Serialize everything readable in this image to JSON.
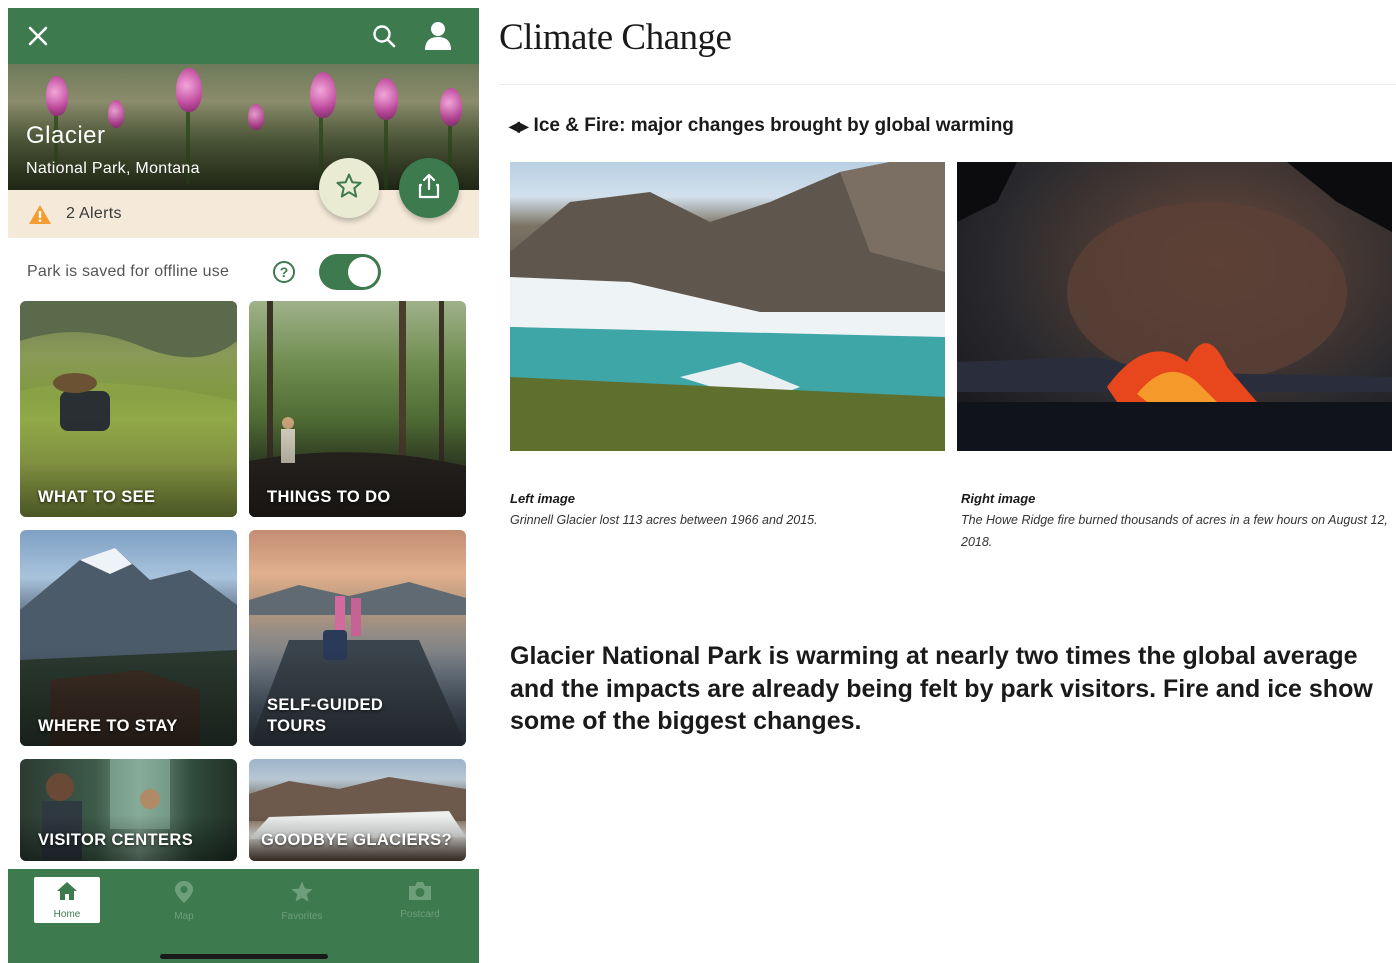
{
  "app": {
    "header": {
      "close_icon": "close-icon",
      "search_icon": "search-icon",
      "profile_icon": "user-icon"
    },
    "park": {
      "name": "Glacier",
      "subtitle": "National Park, Montana"
    },
    "alerts": {
      "label": "2 Alerts",
      "icon": "warning-icon",
      "color": "#f39c32"
    },
    "offline": {
      "label": "Park is saved for offline use",
      "enabled": true
    },
    "tiles": [
      {
        "label": "WHAT TO SEE"
      },
      {
        "label": "THINGS TO DO"
      },
      {
        "label": "WHERE TO STAY"
      },
      {
        "label": "SELF-GUIDED\nTOURS"
      },
      {
        "label": "VISITOR CENTERS"
      },
      {
        "label": "GOODBYE GLACIERS?"
      }
    ],
    "tabs": [
      {
        "label": "Home",
        "icon": "home-icon",
        "active": true
      },
      {
        "label": "Map",
        "icon": "map-pin-icon",
        "active": false
      },
      {
        "label": "Favorites",
        "icon": "star-icon",
        "active": false
      },
      {
        "label": "Postcard",
        "icon": "camera-icon",
        "active": false
      }
    ],
    "colors": {
      "brand_green": "#3d7a4e",
      "alert_bg": "#f5ead9"
    }
  },
  "article": {
    "title": "Climate Change",
    "section_heading": "Ice & Fire: major changes brought by global warming",
    "left_caption": {
      "title": "Left image",
      "text": "Grinnell Glacier lost 113 acres between 1966 and 2015."
    },
    "right_caption": {
      "title": "Right image",
      "text": "The Howe Ridge fire burned thousands of acres in a few hours on August 12, 2018."
    },
    "lead": "Glacier National Park is warming at nearly two times the global average and the impacts are already being felt by park visitors. Fire and ice show some of the biggest changes."
  }
}
